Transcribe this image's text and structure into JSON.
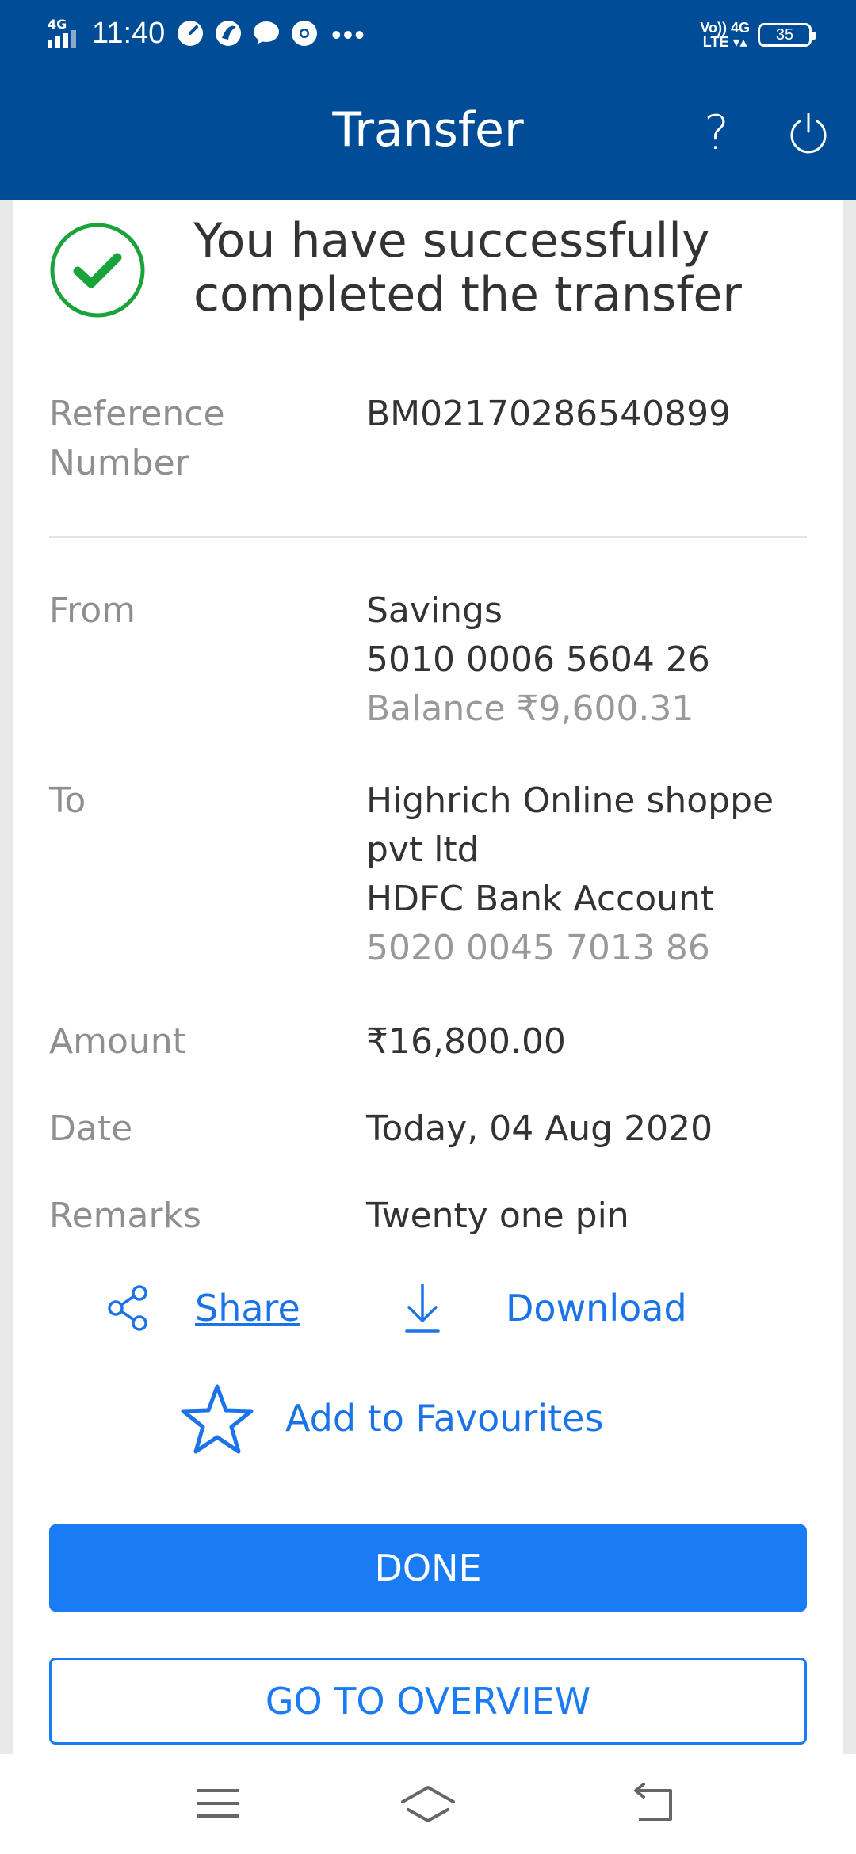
{
  "status_bar": {
    "network": "4G",
    "time": "11:40",
    "volte": "VoLTE",
    "network_right": "4G",
    "battery": "35"
  },
  "header": {
    "title": "Transfer",
    "help_label": "?"
  },
  "success": {
    "message": "You have successfully completed the transfer"
  },
  "details": {
    "reference": {
      "label_line1": "Reference",
      "label_line2": "Number",
      "value": "BM02170286540899"
    },
    "from": {
      "label": "From",
      "account_type": "Savings",
      "account_number": "5010 0006 5604 26",
      "balance": "Balance ₹9,600.31"
    },
    "to": {
      "label": "To",
      "name_line1": "Highrich Online shoppe",
      "name_line2": "pvt ltd",
      "bank": "HDFC Bank Account",
      "account_number": "5020 0045 7013 86"
    },
    "amount": {
      "label": "Amount",
      "value": "₹16,800.00"
    },
    "date": {
      "label": "Date",
      "value": "Today, 04 Aug 2020"
    },
    "remarks": {
      "label": "Remarks",
      "value": "Twenty one pin"
    }
  },
  "actions": {
    "share": "Share",
    "download": "Download",
    "favourites": "Add to Favourites"
  },
  "buttons": {
    "done": "DONE",
    "overview": "GO TO OVERVIEW"
  },
  "colors": {
    "header_blue": "#004c97",
    "accent_blue": "#1a7cf5",
    "success_green": "#1aa33a"
  }
}
